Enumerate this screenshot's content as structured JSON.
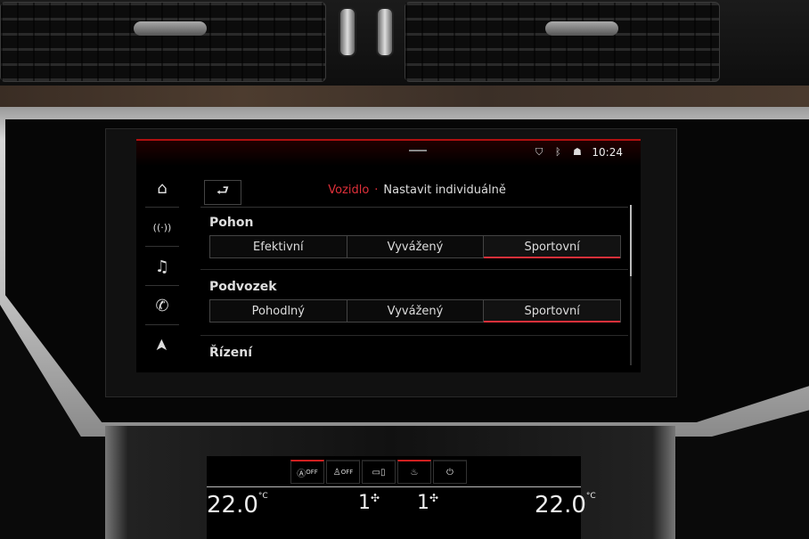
{
  "status_bar": {
    "time": "10:24",
    "icons": [
      "connectivity-icon",
      "bluetooth-icon",
      "user-icon"
    ]
  },
  "sidebar": {
    "items": [
      {
        "icon": "home-icon",
        "glyph": "⌂"
      },
      {
        "icon": "radio-icon",
        "glyph": "((·))"
      },
      {
        "icon": "music-icon",
        "glyph": "♫"
      },
      {
        "icon": "phone-icon",
        "glyph": "✆"
      },
      {
        "icon": "navigation-icon",
        "glyph": "➤"
      }
    ]
  },
  "header": {
    "back_glyph": "⮐",
    "breadcrumb": "Vozidlo",
    "separator": "·",
    "title": "Nastavit individuálně"
  },
  "sections": [
    {
      "label": "Pohon",
      "options": [
        "Efektivní",
        "Vyvážený",
        "Sportovní"
      ],
      "selected": 2
    },
    {
      "label": "Podvozek",
      "options": [
        "Pohodlný",
        "Vyvážený",
        "Sportovní"
      ],
      "selected": 2
    },
    {
      "label": "Řízení"
    }
  ],
  "climate": {
    "left_temp": "22.0",
    "right_temp": "22.0",
    "unit": "°C",
    "left_fan": "1",
    "right_fan": "1",
    "top_icons": [
      {
        "icon": "auto-off-icon",
        "label": "OFF",
        "active": true
      },
      {
        "icon": "seat-off-icon",
        "label": "OFF",
        "active": false
      },
      {
        "icon": "recirculation-icon",
        "label": "",
        "active": false
      },
      {
        "icon": "seat-heat-icon",
        "label": "",
        "active": true
      },
      {
        "icon": "power-icon",
        "label": "",
        "active": false
      }
    ],
    "accent": "#e0303a"
  },
  "colors": {
    "accent": "#e0303a",
    "text": "#dddddd"
  }
}
